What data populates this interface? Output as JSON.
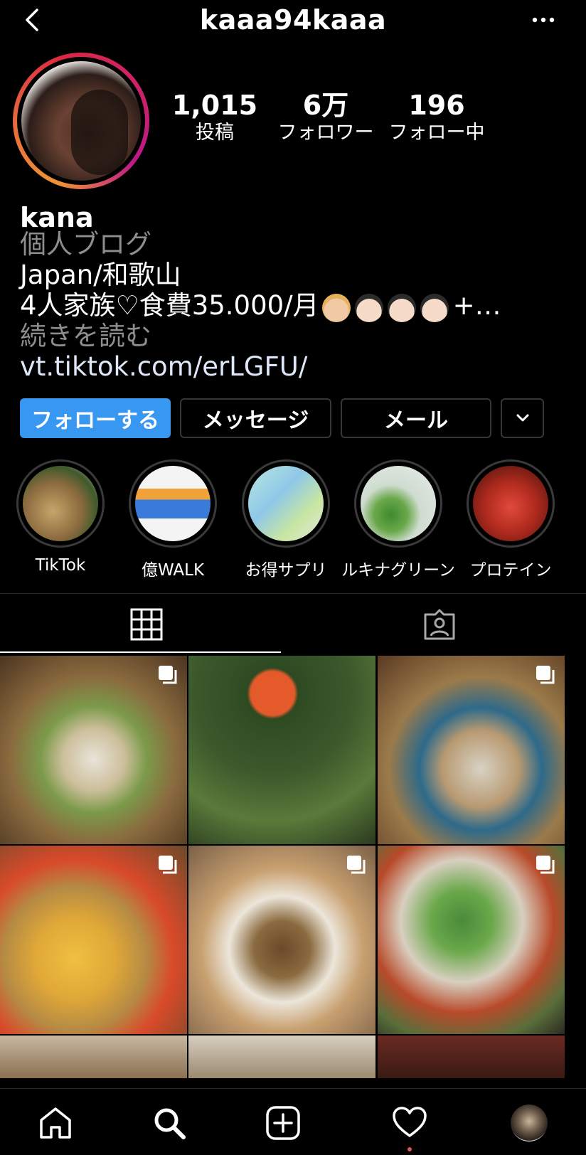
{
  "header": {
    "title": "kaaa94kaaa"
  },
  "stats": [
    {
      "value": "1,015",
      "label": "投稿"
    },
    {
      "value": "6万",
      "label": "フォロワー"
    },
    {
      "value": "196",
      "label": "フォロー中"
    }
  ],
  "profile": {
    "name": "kana",
    "category": "個人ブログ",
    "location": "Japan/和歌山",
    "family_line": "4人家族♡食費35.000/月",
    "family_suffix": "+…",
    "read_more": "続きを読む",
    "link": "vt.tiktok.com/erLGFU/"
  },
  "buttons": {
    "follow": "フォローする",
    "message": "メッセージ",
    "mail": "メール"
  },
  "highlights": [
    {
      "label": "TikTok",
      "color": "#7a6a52"
    },
    {
      "label": "億WALK",
      "color": "#f4f4f4"
    },
    {
      "label": "お得サプリ",
      "color": "#9fd4d8"
    },
    {
      "label": "ルキナグリーン",
      "color": "#c9d9c8"
    },
    {
      "label": "プロテイン",
      "color": "#c23a2a"
    }
  ],
  "grid_tiles": [
    {
      "name": "post-meal-rolls",
      "color": "#8a6a3e",
      "multi": true
    },
    {
      "name": "post-onigiri",
      "color": "#3c5a2c",
      "multi": false
    },
    {
      "name": "post-fish-set",
      "color": "#9b7a4a",
      "multi": true
    },
    {
      "name": "post-ramen",
      "color": "#b58a44",
      "multi": true
    },
    {
      "name": "post-konnyaku",
      "color": "#7a6048",
      "multi": true
    },
    {
      "name": "post-salad-table",
      "color": "#5a6e3a",
      "multi": true
    }
  ],
  "colors": {
    "accent": "#3897f0",
    "notification": "#ed4956"
  }
}
